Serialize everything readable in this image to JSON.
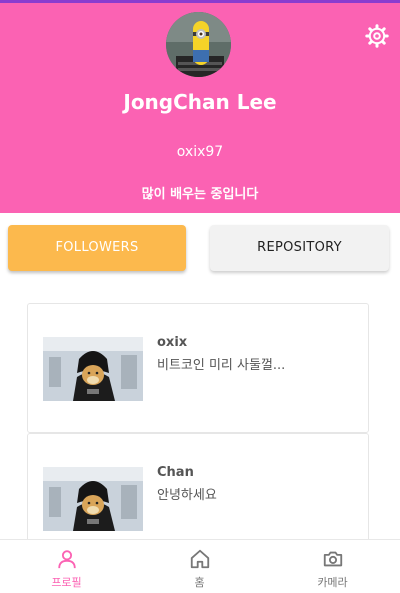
{
  "colors": {
    "header": "#fb62b3",
    "followers_button": "#fcb94d",
    "repository_button": "#f2f2f2",
    "active_nav": "#fb62b3",
    "inactive_nav": "#777777"
  },
  "profile": {
    "name": "JongChan Lee",
    "handle": "oxix97",
    "bio": "많이 배우는 중입니다",
    "avatar_icon": "minion-avatar",
    "settings_icon": "gear-icon"
  },
  "buttons": {
    "followers": "FOLLOWERS",
    "repository": "REPOSITORY"
  },
  "followers": [
    {
      "name": "oxix",
      "text": "비트코인 미리 사둘껄...",
      "thumb_icon": "doge-vader-image"
    },
    {
      "name": "Chan",
      "text": "안녕하세요",
      "thumb_icon": "doge-vader-image"
    }
  ],
  "nav": [
    {
      "label": "프로필",
      "icon": "person-icon",
      "active": true
    },
    {
      "label": "홈",
      "icon": "home-icon",
      "active": false
    },
    {
      "label": "카메라",
      "icon": "camera-icon",
      "active": false
    }
  ]
}
